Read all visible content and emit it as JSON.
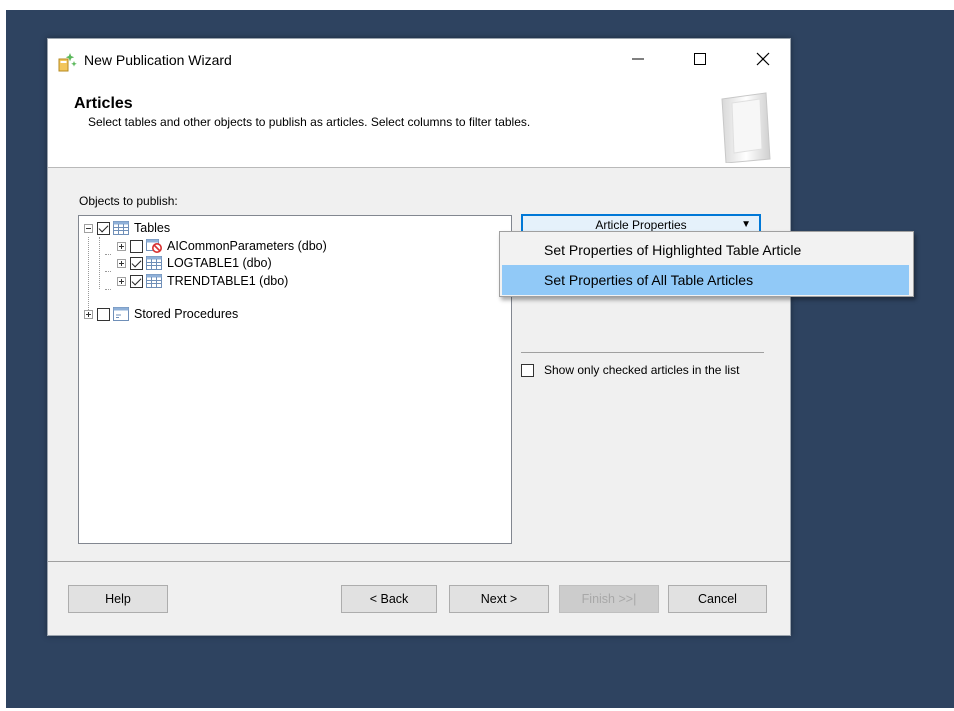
{
  "window": {
    "title": "New Publication Wizard",
    "minimize_glyph": "—",
    "maximize_glyph": "☐",
    "close_glyph": "✕"
  },
  "header": {
    "title": "Articles",
    "subtitle": "Select tables and other objects to publish as articles. Select columns to filter tables."
  },
  "objects_label": "Objects to publish:",
  "tree": {
    "items": [
      {
        "label": "Tables",
        "checked": true,
        "expander": "minus",
        "icon": "table-icon"
      },
      {
        "label": "AICommonParameters (dbo)",
        "checked": false,
        "expander": "plus",
        "icon": "table-not-publishable-icon"
      },
      {
        "label": "LOGTABLE1 (dbo)",
        "checked": true,
        "expander": "plus",
        "icon": "table-icon"
      },
      {
        "label": "TRENDTABLE1 (dbo)",
        "checked": true,
        "expander": "plus",
        "icon": "table-icon"
      },
      {
        "label": "Stored Procedures",
        "checked": false,
        "expander": "plus",
        "icon": "stored-procedure-icon"
      }
    ]
  },
  "article_properties_button": {
    "label": "Article Properties",
    "arrow": "▼"
  },
  "context_menu": {
    "items": [
      {
        "label": "Set Properties of Highlighted Table Article",
        "highlighted": false
      },
      {
        "label": "Set Properties of All Table Articles",
        "highlighted": true
      }
    ]
  },
  "show_only_checked": {
    "label": "Show only checked articles in the list",
    "checked": false
  },
  "footer": {
    "help": "Help",
    "back": "< Back",
    "next": "Next >",
    "finish": "Finish >>|",
    "cancel": "Cancel"
  },
  "colors": {
    "desktop": "#2e4360",
    "menu_highlight": "#91c9f7",
    "button_focus_border": "#0078d7"
  }
}
